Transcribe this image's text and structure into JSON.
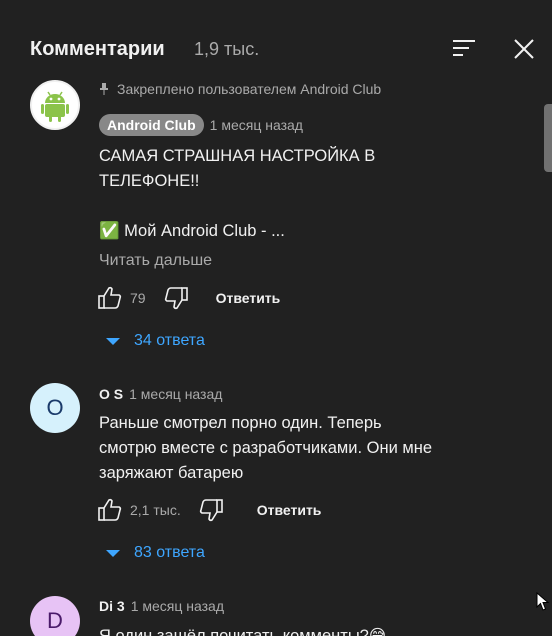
{
  "header": {
    "title": "Комментарии",
    "count": "1,9 тыс."
  },
  "comments": [
    {
      "pinned_label": "Закреплено пользователем Android Club",
      "author": "Android Club",
      "time": "1 месяц назад",
      "text_line1": "САМАЯ СТРАШНАЯ НАСТРОЙКА В",
      "text_line2": "ТЕЛЕФОНЕ!!",
      "text_line3": "✅ Мой Android Club - ...",
      "read_more": "Читать дальше",
      "likes": "79",
      "reply_label": "Ответить",
      "replies_label": "34 ответа"
    },
    {
      "avatar_letter": "O",
      "author": "O S",
      "time": "1 месяц назад",
      "text_line1": "Раньше смотрел порно один. Теперь",
      "text_line2": "смотрю вместе с разработчиками. Они мне",
      "text_line3": "заряжают батарею",
      "likes": "2,1 тыс.",
      "reply_label": "Ответить",
      "replies_label": "83 ответа"
    },
    {
      "avatar_letter": "D",
      "author": "Di 3",
      "time": "1 месяц назад",
      "text_line1": "Я один зашёл почитать комменты?😅"
    }
  ],
  "colors": {
    "panel_bg": "#212121",
    "link_blue": "#3ea6ff",
    "secondary_text": "#aaaaaa"
  }
}
